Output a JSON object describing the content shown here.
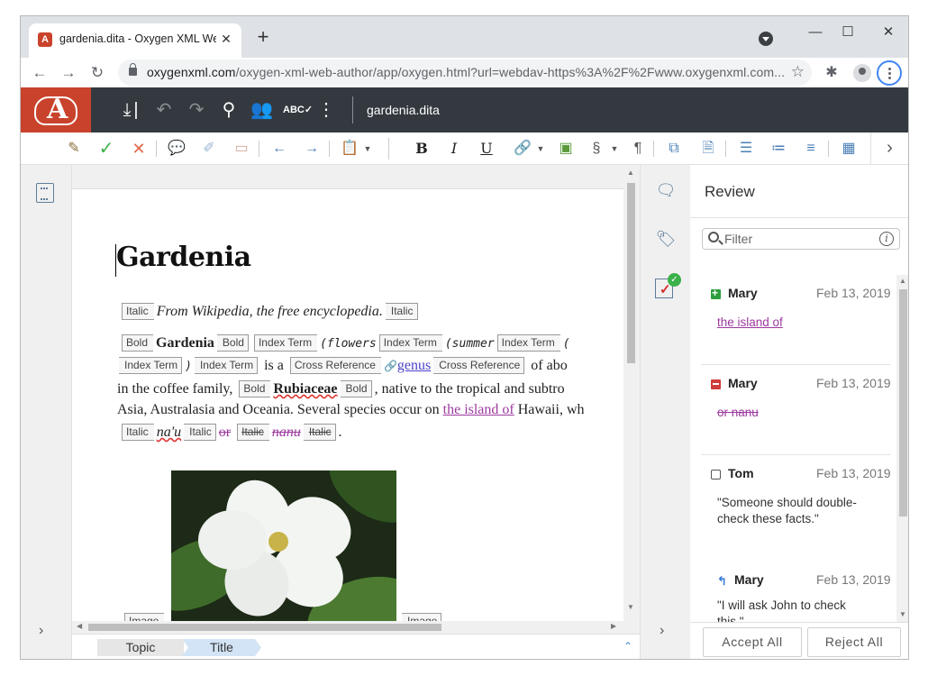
{
  "browser": {
    "tab_title": "gardenia.dita - Oxygen XML Web Author",
    "tab_favicon": "A",
    "url_host": "oxygenxml.com",
    "url_path": "/oxygen-xml-web-author/app/oxygen.html?url=webdav-https%3A%2F%2Fwww.oxygenxml.com..."
  },
  "app": {
    "doc_name": "gardenia.dita"
  },
  "document": {
    "title": "Gardenia",
    "tags": {
      "italic": "Italic",
      "bold": "Bold",
      "index_term": "Index Term",
      "cross_reference": "Cross Reference",
      "image": "Image"
    },
    "line1_text": "From Wikipedia, the free encyclopedia.",
    "line2_bold": "Gardenia",
    "line2_mono1": "(flowers",
    "line2_mono2": "(summer",
    "line2_mono3": "(",
    "line3_paren": ")",
    "line3_isa": "is a",
    "line3_link": "genus",
    "line3_tail": "of abo",
    "line4_lead": "in the coffee family,",
    "line4_bold": "Rubiaceae",
    "line4_tail": ", native to the tropical and subtro",
    "line5_lead": "Asia, Australasia and Oceania. Several species occur on",
    "line5_ins": "the island of",
    "line5_tail": "Hawaii, wh",
    "line6_word": "na'u",
    "line6_del": "or",
    "line6_ins": "nanu",
    "line6_end": "."
  },
  "breadcrumbs": {
    "topic": "Topic",
    "title": "Title"
  },
  "review": {
    "title": "Review",
    "filter_placeholder": "Filter",
    "cards": [
      {
        "author": "Mary",
        "date": "Feb 13, 2019",
        "text": "the island of"
      },
      {
        "author": "Mary",
        "date": "Feb 13, 2019",
        "text": "or nanu"
      },
      {
        "author": "Tom",
        "date": "Feb 13, 2019",
        "text": "\"Someone should double-check these facts.\""
      },
      {
        "author": "Mary",
        "date": "Feb 13, 2019",
        "text": "\"I will ask John to check this.\""
      }
    ],
    "accept_all": "Accept All",
    "reject_all": "Reject All"
  }
}
